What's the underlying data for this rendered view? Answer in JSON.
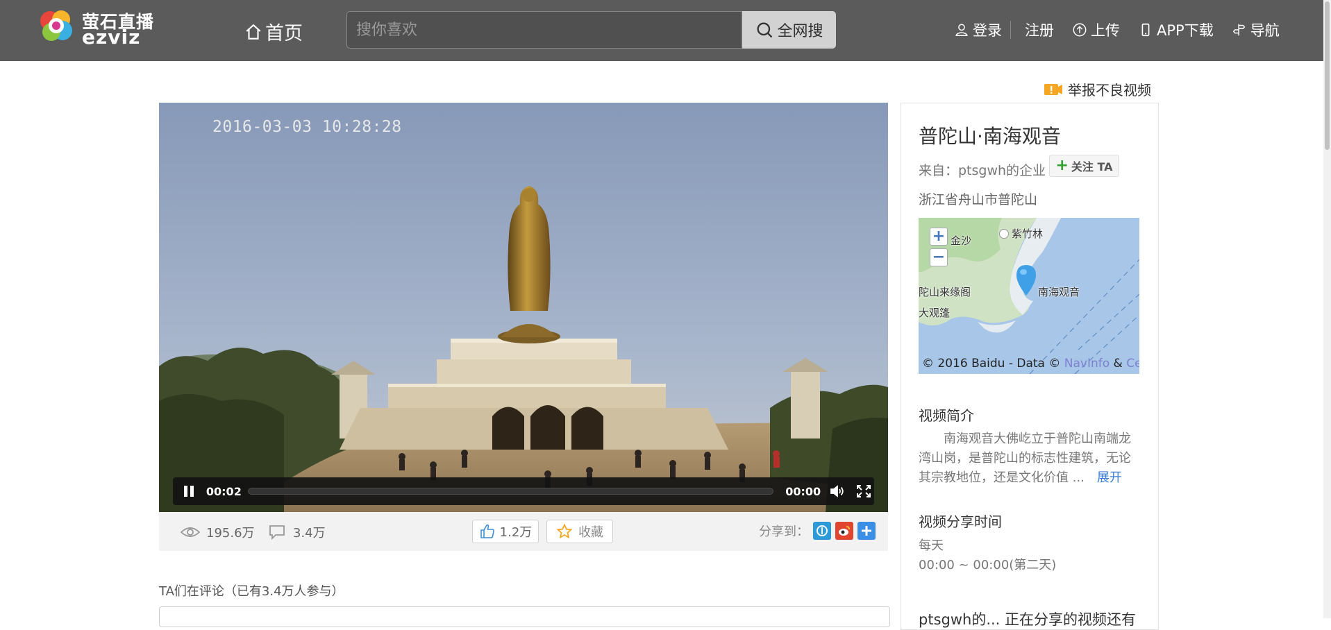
{
  "header": {
    "logo_cn": "萤石直播",
    "logo_en": "ezviz",
    "home_label": "首页",
    "search_placeholder": "搜你喜欢",
    "search_button": "全网搜",
    "nav": {
      "login": "登录",
      "register": "注册",
      "upload": "上传",
      "app": "APP下载",
      "guide": "导航"
    }
  },
  "report_label": "举报不良视频",
  "video": {
    "osd_timestamp": "2016-03-03 10:28:28",
    "current_time": "00:02",
    "duration": "00:00",
    "progress_fraction": 0.0
  },
  "stats": {
    "views": "195.6万",
    "comments": "3.4万",
    "likes": "1.2万",
    "favorite_label": "收藏",
    "share_label": "分享到："
  },
  "comments_title": "TA们在评论（已有3.4万人参与）",
  "sidebar": {
    "title": "普陀山·南海观音",
    "from": "来自：ptsgwh的企业",
    "follow_label": "关注 TA",
    "location": "浙江省舟山市普陀山",
    "map": {
      "labels": {
        "jinsha": "金沙",
        "zizhulin": "紫竹林",
        "nanhai": "南海观音",
        "laiyuange": "陀山来缘阁",
        "daguanfeng": "大观篷"
      },
      "attribution": "© 2016 Baidu - Data © ",
      "attribution_link1": "NavInfo",
      "attribution_amp": " & ",
      "attribution_link2": "CenN"
    },
    "intro_heading": "视频简介",
    "intro_text": "南海观音大佛屹立于普陀山南端龙湾山岗，是普陀山的标志性建筑，无论其宗教地位，还是文化价值 ...",
    "expand_label": "展开",
    "share_time_heading": "视频分享时间",
    "share_time_day": "每天",
    "share_time_range": "00:00 ~ 00:00(第二天)",
    "more_heading": "ptsgwh的... 正在分享的视频还有"
  },
  "colors": {
    "topbar": "#5b5b5b",
    "accent_link": "#3b7fd9",
    "follow_plus": "#2ea12e",
    "report_badge": "#f5a623",
    "map_water": "#a8c6e8"
  }
}
